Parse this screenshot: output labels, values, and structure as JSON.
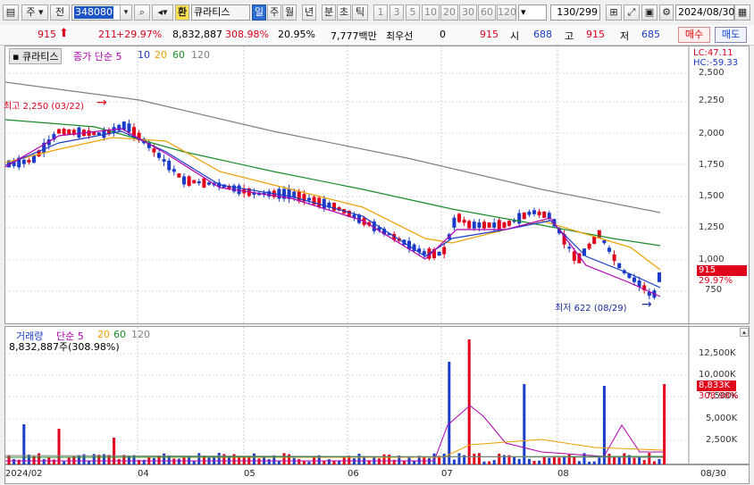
{
  "toolbar": {
    "type_label": "주",
    "prev_label": "전",
    "code": "348080",
    "name_label": "큐라티스",
    "exchange_label": "환",
    "periods": [
      "일",
      "주",
      "월",
      "년",
      "분",
      "초",
      "틱"
    ],
    "selected_period": "일",
    "intervals": [
      "1",
      "3",
      "5",
      "10",
      "20",
      "30",
      "60",
      "120"
    ],
    "count": "130/299",
    "date": "2024/08/30"
  },
  "info": {
    "price": "915",
    "change": "211",
    "change_pct": "+29.97%",
    "volume": "8,832,887",
    "volume_ratio": "308.98%",
    "turnover": "20.95%",
    "amount": "7,777백만",
    "pref_label": "최우선",
    "pref_value": "0",
    "pref_price": "915",
    "open_label": "시",
    "open_value": "688",
    "high_label": "고",
    "high_value": "915",
    "low_label": "저",
    "low_value": "685",
    "buy_label": "매수",
    "sell_label": "매도"
  },
  "price_panel": {
    "name": "큐라티스",
    "legend_prefix": "종가 단순",
    "ma": [
      "5",
      "10",
      "20",
      "60",
      "120"
    ],
    "ma_colors": [
      "#b000b0",
      "#1a3cc8",
      "#f0a000",
      "#1a8c2a",
      "#808080"
    ],
    "lc": "LC:47.11",
    "hc": "HC:-59.33",
    "high_note": "최고 2,250 (03/22)",
    "low_note": "최저 622 (08/29)",
    "last_tag": "915",
    "last_pct": "29.97%",
    "yticks": [
      "2,500",
      "2,250",
      "2,000",
      "1,750",
      "1,500",
      "1,250",
      "1,000",
      "750"
    ]
  },
  "volume_panel": {
    "legend_name": "거래량",
    "legend_prefix": "단순",
    "ma": [
      "5",
      "20",
      "60",
      "120"
    ],
    "value_label": "8,832,887주(308.98%)",
    "yticks": [
      "12,500K",
      "10,000K",
      "7,500K",
      "5,000K",
      "2,500K"
    ],
    "last_tag": "8,833K",
    "last_pct": "308.98%"
  },
  "xaxis": {
    "labels": [
      "2024/02",
      "04",
      "05",
      "06",
      "07",
      "08"
    ],
    "end_label": "08/30"
  }
}
